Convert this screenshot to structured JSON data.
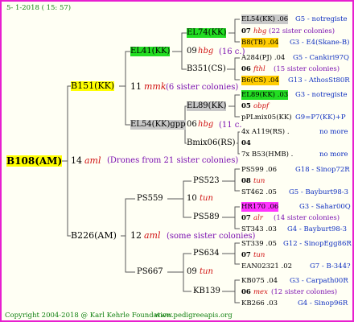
{
  "header": {
    "date": "5- 1-2018 ( 15: 57)"
  },
  "footer": {
    "copyright": "Copyright 2004-2018 @ Karl Kehrle Foundation.",
    "site": "www.pedigreeapis.org"
  },
  "root": {
    "label": "B108(AM)",
    "year": "14",
    "breeder": "aml",
    "note": "(Drones from 21 sister colonies)"
  },
  "gen1": {
    "top": {
      "label": "B151(KK)",
      "year": "11",
      "breeder": "mmk",
      "note": "(6 sister colonies)"
    },
    "bottom": {
      "label": "B226(AM)",
      "year": "12",
      "breeder": "aml",
      "note": "(some sister colonies)"
    }
  },
  "gen2": {
    "a": {
      "label": "EL41(KK)",
      "year": "09",
      "breeder": "hbg",
      "note": "(16 c.)"
    },
    "b": {
      "label": "EL54(KK)gpp",
      "year": "06",
      "breeder": "hbg",
      "note": "(11 c."
    },
    "c": {
      "label": "PS559",
      "year": "10",
      "breeder": "tun"
    },
    "d": {
      "label": "PS667",
      "year": "09",
      "breeder": "tun"
    }
  },
  "gen3": {
    "a1": {
      "label": "EL74(KK)"
    },
    "a2": {
      "label": "B351(CS)"
    },
    "b1": {
      "label": "EL89(KK)"
    },
    "b2": {
      "label": "Bmix06(RS)"
    },
    "c1": {
      "label": "PS523"
    },
    "c2": {
      "label": "PS589"
    },
    "d1": {
      "label": "PS634"
    },
    "d2": {
      "label": "KB139"
    }
  },
  "gen4": {
    "r1": {
      "label": "EL54(KK) .06",
      "line": "G5 - notregiste"
    },
    "r2": {
      "year": "07",
      "breeder": "hbg",
      "note": "(22 sister colonies)"
    },
    "r3": {
      "label": "B8(TB) .04",
      "line": "G3 - E4(Skane-B)"
    },
    "r4": {
      "label": "A284(PJ) .04",
      "line": "G5 - Cankiri97Q"
    },
    "r5": {
      "year": "06",
      "breeder": "fthl",
      "note": "(15 sister colonies)"
    },
    "r6": {
      "label": "B6(CS) .04",
      "line": "G13 - AthosSt80R"
    },
    "r7": {
      "label": "EL89(KK) .03",
      "line": "G3 - notregiste"
    },
    "r8": {
      "year": "05",
      "breeder": "obpf",
      "note": ""
    },
    "r9": {
      "label": "pPLmix05(KK)",
      "line": "G9=P7(KK)+P"
    },
    "r10": {
      "label": "4x A119(RS) .",
      "line": "no more"
    },
    "r11": {
      "year": "04",
      "breeder": "",
      "note": ""
    },
    "r12": {
      "label": "7x B53(HMB) .",
      "line": "no more"
    },
    "r13": {
      "label": "PS599 .06",
      "line": "G18 - Sinop72R"
    },
    "r14": {
      "year": "08",
      "breeder": "tun",
      "note": ""
    },
    "r15": {
      "label": "ST462 .05",
      "line": "G5 - Bayburt98-3"
    },
    "r16": {
      "label": "HR170 .06",
      "line": "G3 - Sahar00Q"
    },
    "r17": {
      "year": "07",
      "breeder": "alr",
      "note": "(14 sister colonies)"
    },
    "r18": {
      "label": "ST343 .03",
      "line": "G4 - Bayburt98-3"
    },
    "r19": {
      "label": "ST339 .05",
      "line": "G12 - SinopEgg86R"
    },
    "r20": {
      "year": "07",
      "breeder": "tun",
      "note": ""
    },
    "r21": {
      "label": "EAN02321 .02",
      "line": "G7 - B-344?"
    },
    "r22": {
      "label": "KB075 .04",
      "line": "G3 - Carpath00R"
    },
    "r23": {
      "year": "06",
      "breeder": "mex",
      "note": "(12 sister colonies)"
    },
    "r24": {
      "label": "KB266 .03",
      "line": "G4 - Sinop96R"
    }
  }
}
